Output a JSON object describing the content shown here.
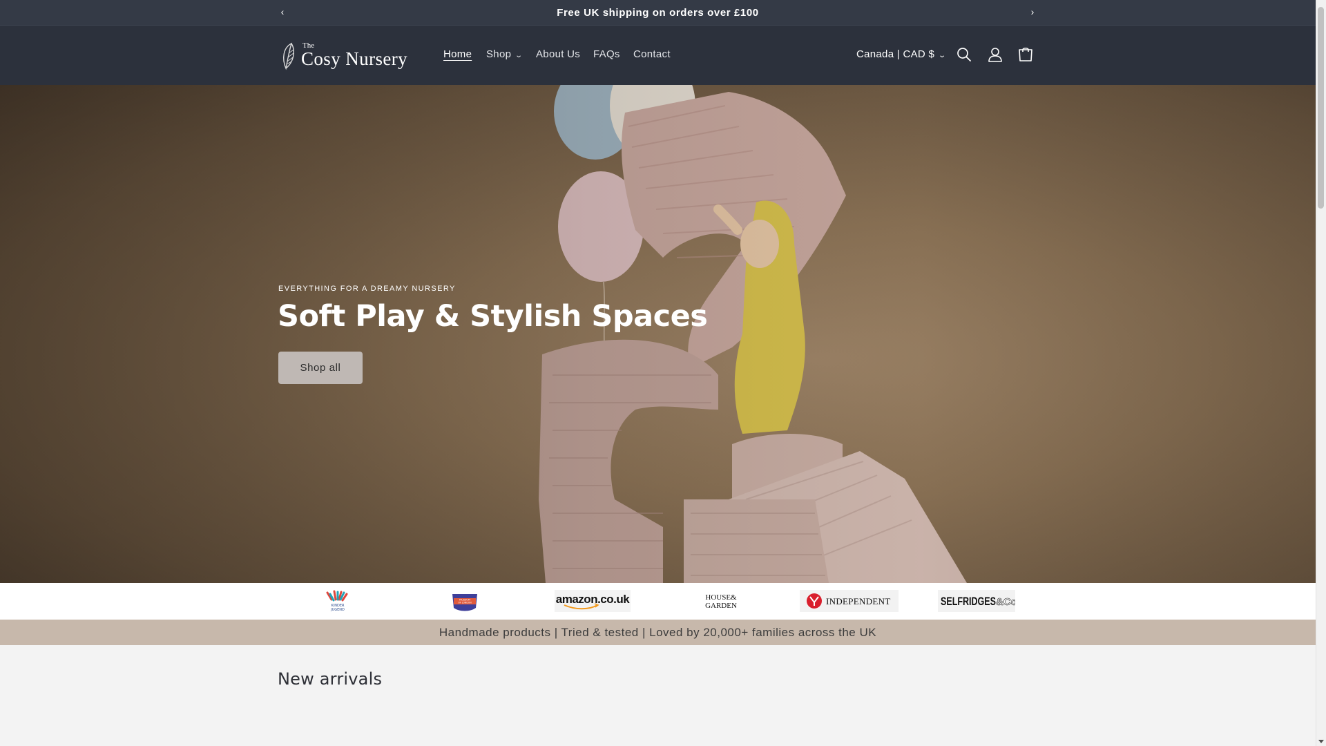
{
  "announcement": {
    "text": "Free UK shipping on orders over £100",
    "prev_icon": "chevron-left-icon",
    "next_icon": "chevron-right-icon"
  },
  "header": {
    "logo": {
      "the": "The",
      "name": "Cosy Nursery"
    },
    "nav": [
      {
        "label": "Home",
        "active": true
      },
      {
        "label": "Shop",
        "has_dropdown": true
      },
      {
        "label": "About Us"
      },
      {
        "label": "FAQs"
      },
      {
        "label": "Contact"
      }
    ],
    "currency": "Canada | CAD $",
    "icons": [
      "search-icon",
      "account-icon",
      "cart-icon"
    ]
  },
  "hero": {
    "eyebrow": "EVERYTHING FOR A DREAMY NURSERY",
    "title": "Soft Play & Stylish Spaces",
    "button": "Shop all"
  },
  "press_logos": {
    "kinder": [
      "KINDER",
      "JUGEND"
    ],
    "museum": [
      "MUSEUM",
      "OF LONDON"
    ],
    "amazon": "amazon.co.uk",
    "house_garden": [
      "HOUSE&",
      "GARDEN"
    ],
    "independent": "INDEPENDENT",
    "selfridges": {
      "main": "SELFRIDGES",
      "suffix": "&Co"
    }
  },
  "tagline": "Handmade products | Tried & tested | Loved by 20,000+ families across the UK",
  "sections": {
    "new_arrivals": "New arrivals"
  },
  "colors": {
    "announcement_bg": "#343a46",
    "header_bg": "#2c313c",
    "tagline_bg": "#c7b8ab",
    "hero_button_bg": "#bfb8b4"
  }
}
